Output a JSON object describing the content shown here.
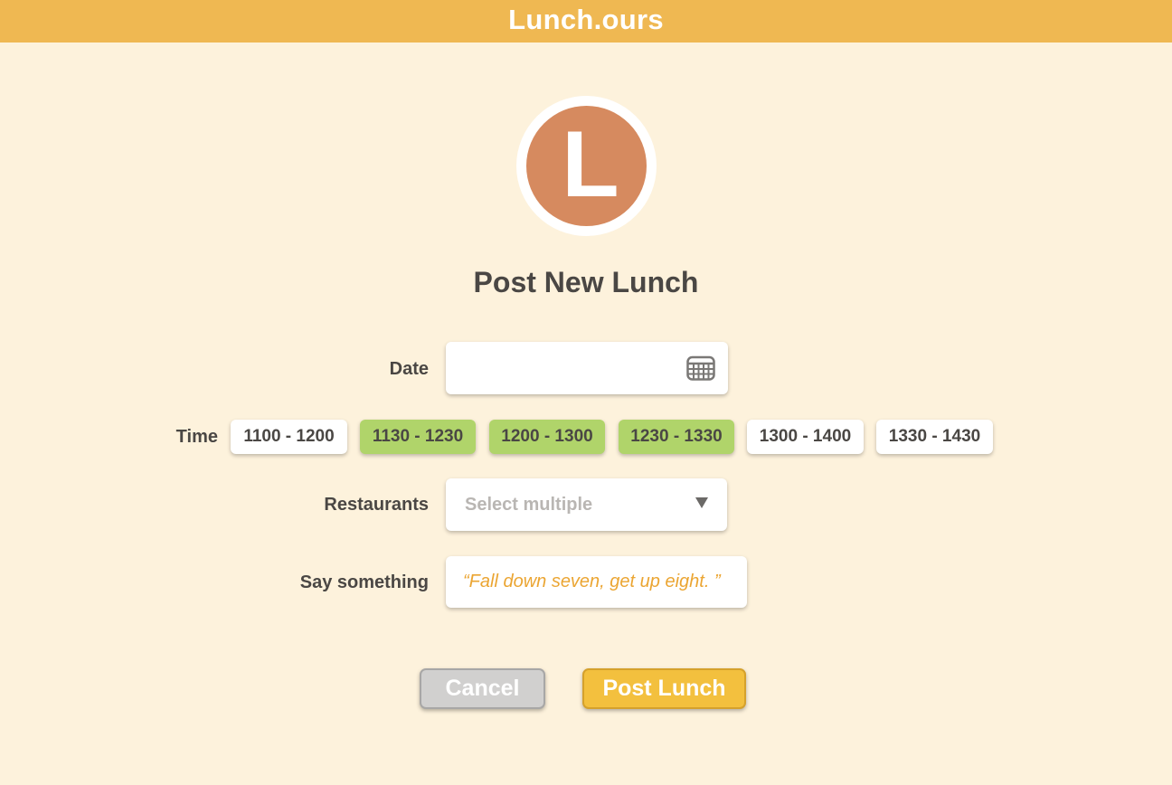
{
  "app": {
    "title": "Lunch.ours"
  },
  "logo": {
    "letter": "L"
  },
  "page": {
    "title": "Post New Lunch"
  },
  "form": {
    "date": {
      "label": "Date",
      "value": "",
      "icon": "calendar-icon"
    },
    "time": {
      "label": "Time",
      "slots": [
        {
          "label": "1100 - 1200",
          "selected": false
        },
        {
          "label": "1130 - 1230",
          "selected": true
        },
        {
          "label": "1200 - 1300",
          "selected": true
        },
        {
          "label": "1230 - 1330",
          "selected": true
        },
        {
          "label": "1300 - 1400",
          "selected": false
        },
        {
          "label": "1330 - 1430",
          "selected": false
        }
      ]
    },
    "restaurants": {
      "label": "Restaurants",
      "placeholder": "Select multiple",
      "icon": "caret-down-icon"
    },
    "say_something": {
      "label": "Say something",
      "value": "“Fall down seven, get up eight. ”"
    }
  },
  "actions": {
    "cancel_label": "Cancel",
    "post_label": "Post Lunch"
  },
  "colors": {
    "header": "#efb852",
    "background": "#fdf2dc",
    "logo": "#d68a5f",
    "slot_selected": "#b0d46a",
    "quote_text": "#eba532",
    "post_button": "#f3c03e",
    "cancel_button": "#d1d0cf"
  }
}
